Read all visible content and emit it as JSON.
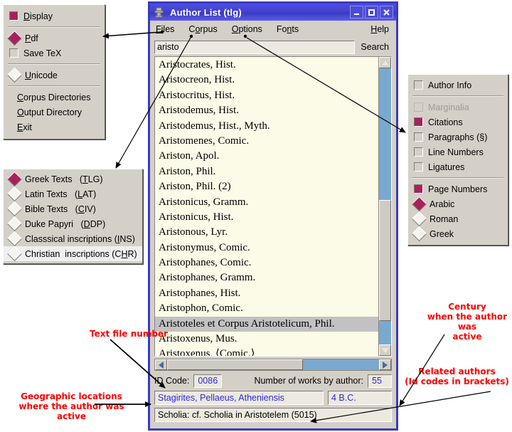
{
  "window": {
    "title": "Author List (tlg)",
    "icon": "app-stamp-icon",
    "minimize": "_",
    "maximize": "□",
    "close": "✕",
    "titlebar_color": "#4343cf",
    "border_color": "#3b3bbf"
  },
  "menubar": {
    "items": [
      "Files",
      "Corpus",
      "Options",
      "Fonts"
    ],
    "help": "Help"
  },
  "search": {
    "value": "aristo",
    "placeholder": "",
    "button": "Search"
  },
  "files_menu": {
    "groups": [
      [
        {
          "label": "Display",
          "indicator": "check",
          "state": "on"
        }
      ],
      [
        {
          "label": "Pdf",
          "indicator": "diamond",
          "state": "on"
        },
        {
          "label": "Save TeX",
          "indicator": "check",
          "state": "off"
        }
      ],
      [
        {
          "label": "Unicode",
          "indicator": "diamond",
          "state": "off"
        }
      ],
      [
        {
          "label": "Corpus Directories",
          "indicator": "none",
          "state": "off"
        },
        {
          "label": "Output Directory",
          "indicator": "none",
          "state": "off"
        },
        {
          "label": "Exit",
          "indicator": "none",
          "state": "off"
        }
      ]
    ]
  },
  "corpus_menu": {
    "items": [
      {
        "label": "Greek Texts   (TLG)",
        "state": "on",
        "highlight": false
      },
      {
        "label": "Latin Texts   (LAT)",
        "state": "off",
        "highlight": false
      },
      {
        "label": "Bible Texts   (CIV)",
        "state": "off",
        "highlight": false
      },
      {
        "label": "Duke Papyri    (DDP)",
        "state": "off",
        "highlight": false
      },
      {
        "label": "Classsical inscriptions (INS)",
        "state": "off",
        "highlight": false
      },
      {
        "label": "Christian  inscriptions (CHR)",
        "state": "off",
        "highlight": true
      }
    ]
  },
  "options_menu": {
    "groups": [
      [
        {
          "label": "Author Info",
          "indicator": "check",
          "state": "off",
          "disabled": false
        }
      ],
      [
        {
          "label": "Marginalia",
          "indicator": "check",
          "state": "off",
          "disabled": true
        },
        {
          "label": "Citations",
          "indicator": "check",
          "state": "on",
          "disabled": false
        },
        {
          "label": "Paragraphs (§)",
          "indicator": "check",
          "state": "off",
          "disabled": false
        },
        {
          "label": "Line Numbers",
          "indicator": "check",
          "state": "off",
          "disabled": false
        },
        {
          "label": "Ligatures",
          "indicator": "check",
          "state": "off",
          "disabled": false
        }
      ],
      [
        {
          "label": "Page Numbers",
          "indicator": "check",
          "state": "on",
          "disabled": false
        },
        {
          "label": "Arabic",
          "indicator": "diamond",
          "state": "on",
          "disabled": false
        },
        {
          "label": "Roman",
          "indicator": "diamond",
          "state": "off",
          "disabled": false
        },
        {
          "label": "Greek",
          "indicator": "diamond",
          "state": "off",
          "disabled": false
        }
      ]
    ]
  },
  "author_list": {
    "rows": [
      {
        "text": "Aristocrates,  Hist.",
        "selected": false
      },
      {
        "text": "Aristocreon,  Hist.",
        "selected": false
      },
      {
        "text": "Aristocritus,  Hist.",
        "selected": false
      },
      {
        "text": "Aristodemus,  Hist.",
        "selected": false
      },
      {
        "text": "Aristodemus,  Hist., Myth.",
        "selected": false
      },
      {
        "text": "Aristomenes,  Comic.",
        "selected": false
      },
      {
        "text": "Ariston,  Apol.",
        "selected": false
      },
      {
        "text": "Ariston,  Phil.",
        "selected": false
      },
      {
        "text": "Ariston,  Phil. (2)",
        "selected": false
      },
      {
        "text": "Aristonicus,  Gramm.",
        "selected": false
      },
      {
        "text": "Aristonicus,  Hist.",
        "selected": false
      },
      {
        "text": "Aristonous,  Lyr.",
        "selected": false
      },
      {
        "text": "Aristonymus,  Comic.",
        "selected": false
      },
      {
        "text": "Aristophanes,  Comic.",
        "selected": false
      },
      {
        "text": "Aristophanes,  Gramm.",
        "selected": false
      },
      {
        "text": "Aristophanes,  Hist.",
        "selected": false
      },
      {
        "text": "Aristophon,  Comic.",
        "selected": false
      },
      {
        "text": "Aristoteles et Corpus Aristotelicum,  Phil.",
        "selected": true
      },
      {
        "text": "Aristoxenus,  Mus.",
        "selected": false
      },
      {
        "text": "Aristoxenus, ⟨Comic.⟩",
        "selected": false
      }
    ]
  },
  "info": {
    "id_label": "ID Code:",
    "id_value": "0086",
    "works_label": "Number of works by author:",
    "works_value": "55",
    "geography": "Stagirites, Pellaeus, Atheniensis",
    "century": "4 B.C.",
    "related": "Scholia: cf. Scholia in Aristotelem (5015)"
  },
  "annotations": [
    {
      "id": "text-file-number",
      "lines": [
        "Text file number"
      ]
    },
    {
      "id": "geographic-locations",
      "lines": [
        "Geographic locations",
        "where the author was",
        "active"
      ]
    },
    {
      "id": "century-active",
      "lines": [
        "Century",
        "when the author was",
        "active"
      ]
    },
    {
      "id": "related-authors",
      "lines": [
        "Related authors",
        "(Id codes in brackets)"
      ]
    }
  ],
  "colors": {
    "accent": "#a8215b",
    "annotation": "#ff0000",
    "value_text": "#2b2bd6",
    "scrollbar_trough": "#7aa9cf",
    "list_bg": "#fbfbe8"
  }
}
